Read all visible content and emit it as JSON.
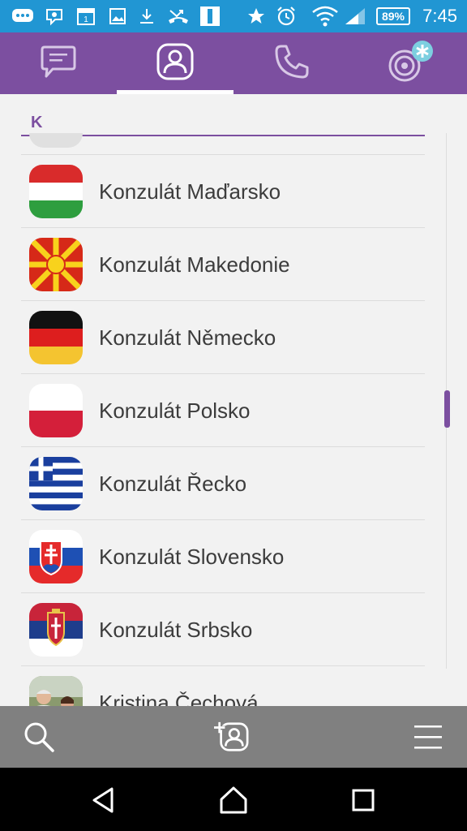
{
  "status_bar": {
    "time": "7:45",
    "battery_percent": "89%",
    "icons": [
      "messages-icon",
      "viber-icon",
      "calendar-icon",
      "gallery-icon",
      "download-icon",
      "missed-call-icon",
      "app-icon",
      "star-icon",
      "alarm-icon",
      "wifi-icon",
      "signal-icon",
      "battery-icon"
    ],
    "calendar_day": "1"
  },
  "top_tabs": [
    {
      "id": "chats",
      "icon": "chat-bubble-icon",
      "active": false
    },
    {
      "id": "contacts",
      "icon": "contacts-icon",
      "active": true
    },
    {
      "id": "calls",
      "icon": "phone-icon",
      "active": false
    },
    {
      "id": "public",
      "icon": "public-accounts-icon",
      "active": false
    }
  ],
  "section": {
    "letter": "K"
  },
  "contacts": [
    {
      "name": "Konzulát Maďarsko",
      "avatar": "flag-hungary"
    },
    {
      "name": "Konzulát Makedonie",
      "avatar": "flag-macedonia"
    },
    {
      "name": "Konzulát Německo",
      "avatar": "flag-germany"
    },
    {
      "name": "Konzulát Polsko",
      "avatar": "flag-poland"
    },
    {
      "name": "Konzulát Řecko",
      "avatar": "flag-greece"
    },
    {
      "name": "Konzulát Slovensko",
      "avatar": "flag-slovakia"
    },
    {
      "name": "Konzulát Srbsko",
      "avatar": "flag-serbia"
    },
    {
      "name": "Kristina Čechová",
      "avatar": "photo"
    }
  ],
  "bottom_bar": {
    "icons": [
      "search-icon",
      "add-contact-icon",
      "menu-icon"
    ]
  },
  "nav_bar": {
    "icons": [
      "back-icon",
      "home-icon",
      "recents-icon"
    ]
  },
  "colors": {
    "accent": "#7c4fa0",
    "status_bar": "#2196d3",
    "bottom_bar": "#808080"
  }
}
